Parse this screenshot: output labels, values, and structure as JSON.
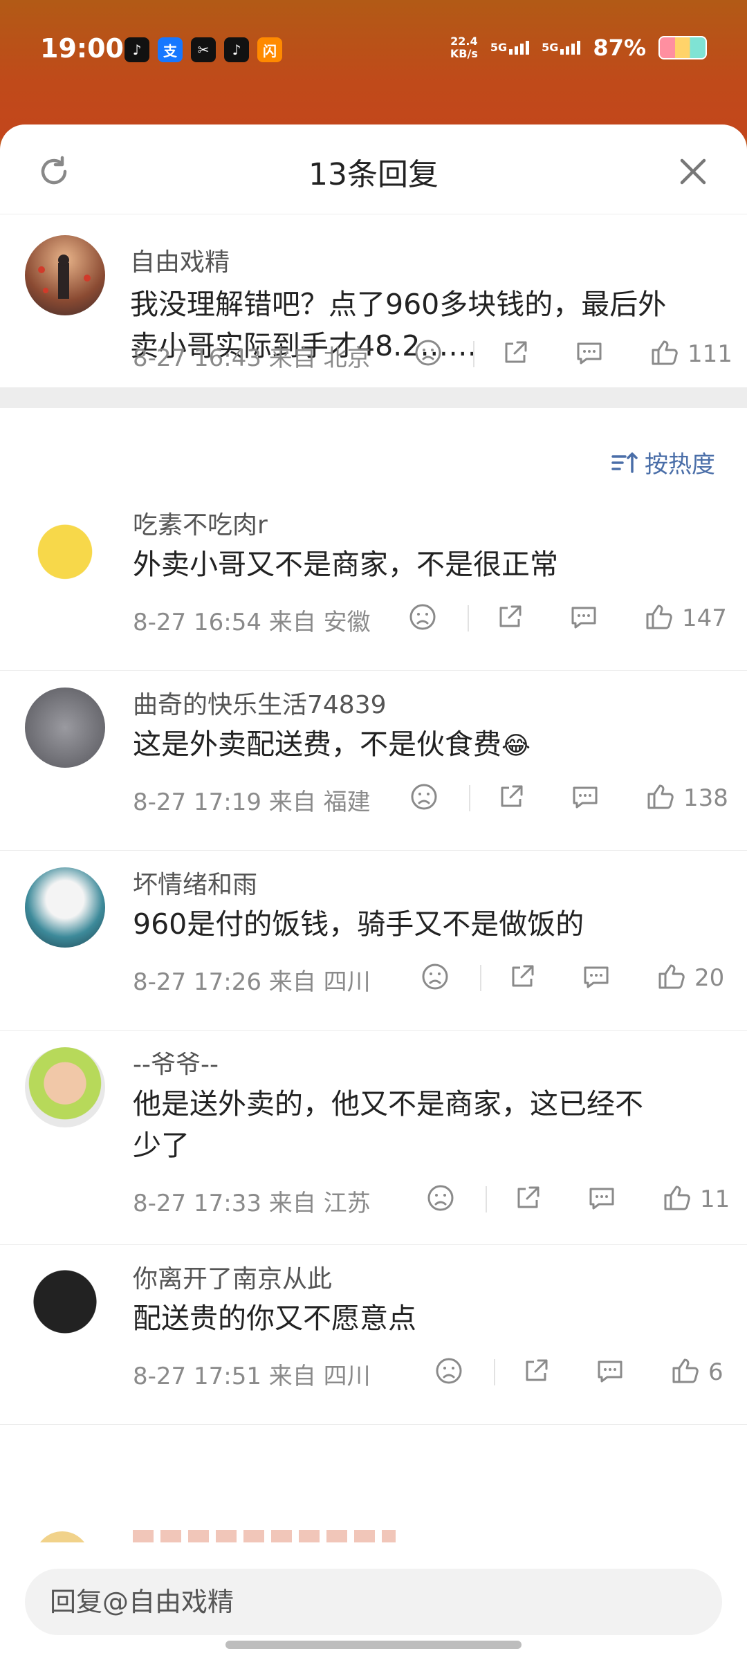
{
  "status_bar": {
    "time": "19:00",
    "net_speed_top": "22.4",
    "net_speed_bottom": "KB/s",
    "signal1": "5G",
    "signal2": "5G",
    "battery": "87%",
    "app_icons": [
      "tiktok-icon",
      "alipay-icon",
      "capcut-icon",
      "tiktok-lite-icon",
      "taobao-flash-icon"
    ],
    "app_icon_glyphs": [
      "♪",
      "支",
      "✂",
      "♪",
      "闪"
    ],
    "app_icon_colors": [
      "#111111",
      "#1677ff",
      "#111111",
      "#111111",
      "#ff8a00"
    ]
  },
  "sheet": {
    "title": "13条回复",
    "main_comment": {
      "username": "自由戏精",
      "text_line1": "我没理解错吧？点了960多块钱的，最后外",
      "text_line2": "卖小哥实际到手才48.2……",
      "meta": "8-27 16:43  来自 北京",
      "likes": "111"
    },
    "sort_label": "按热度",
    "replies": [
      {
        "username": "吃素不吃肉r",
        "text": "外卖小哥又不是商家，不是很正常",
        "meta": "8-27 16:54  来自 安徽",
        "likes": "147"
      },
      {
        "username": "曲奇的快乐生活74839",
        "text": "这是外卖配送费，不是伙食费",
        "emoji": "😂",
        "meta": "8-27 17:19  来自 福建",
        "likes": "138"
      },
      {
        "username": "坏情绪和雨",
        "text": "960是付的饭钱，骑手又不是做饭的",
        "meta": "8-27 17:26  来自 四川",
        "likes": "20"
      },
      {
        "username": "--爷爷--",
        "text_line1": "他是送外卖的，他又不是商家，这已经不",
        "text_line2": "少了",
        "meta": "8-27 17:33  来自 江苏",
        "likes": "11"
      },
      {
        "username": "你离开了南京从此",
        "text": "配送贵的你又不愿意点",
        "meta": "8-27 17:51  来自 四川",
        "likes": "6"
      }
    ],
    "reply_input_placeholder": "回复@自由戏精"
  },
  "colors": {
    "accent": "#4a6ea8",
    "meta_gray": "#8a8a8a",
    "background_orange": "#c2541c"
  }
}
